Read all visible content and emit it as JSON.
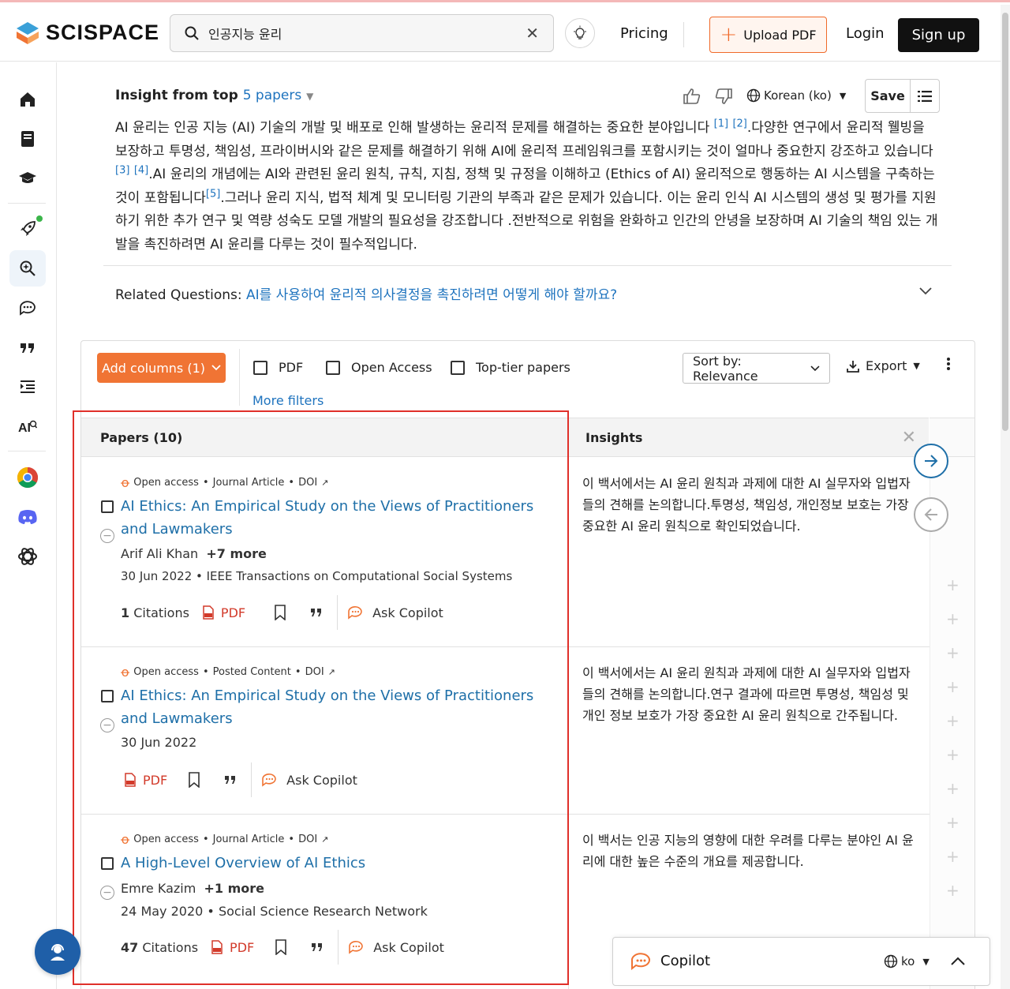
{
  "header": {
    "logo_text": "SCISPACE",
    "search_query": "인공지능 윤리",
    "pricing_label": "Pricing",
    "upload_label": "Upload PDF",
    "login_label": "Login",
    "signup_label": "Sign up"
  },
  "sidebar": {
    "items": [
      "home-icon",
      "library-icon",
      "graduation-cap-icon",
      "rocket-icon",
      "search-literature-icon",
      "chat-icon",
      "quote-icon",
      "outline-icon",
      "ai-detector-icon",
      "chrome-icon",
      "discord-icon",
      "openai-icon"
    ],
    "active_item": "search-literature-icon"
  },
  "insight": {
    "heading_prefix": "Insight from top",
    "papers_link": "5 papers",
    "language": "Korean (ko)",
    "save_label": "Save",
    "body": {
      "s1": "AI 윤리는 인공 지능 (AI) 기술의 개발 및 배포로 인해 발생하는 윤리적 문제를 해결하는 중요한 분야입니다",
      "c1": "[1]",
      "c2": "[2]",
      "s2": ".다양한 연구에서 윤리적 웰빙을 보장하고 투명성, 책임성, 프라이버시와 같은 문제를 해결하기 위해 AI에 윤리적 프레임워크를 포함시키는 것이 얼마나 중요한지 강조하고 있습니다",
      "c3": "[3]",
      "c4": "[4]",
      "s3": ".AI 윤리의 개념에는 AI와 관련된 윤리 원칙, 규칙, 지침, 정책 및 규정을 이해하고 (Ethics of AI) 윤리적으로 행동하는 AI 시스템을 구축하는 것이 포함됩니다",
      "c5": "[5]",
      "s4": ".그러나 윤리 지식, 법적 체계 및 모니터링 기관의 부족과 같은 문제가 있습니다. 이는 윤리 인식 AI 시스템의 생성 및 평가를 지원하기 위한 추가 연구 및 역량 성숙도 모델 개발의 필요성을 강조합니다 .전반적으로 위험을 완화하고 인간의 안녕을 보장하며 AI 기술의 책임 있는 개발을 촉진하려면 AI 윤리를 다루는 것이 필수적입니다."
    },
    "related_label": "Related Questions:",
    "related_question": "AI를 사용하여 윤리적 의사결정을 촉진하려면 어떻게 해야 할까요?"
  },
  "toolbar": {
    "add_columns_label": "Add columns (1)",
    "filters": [
      "PDF",
      "Open Access",
      "Top-tier papers"
    ],
    "more_filters": "More filters",
    "sort_label": "Sort by: Relevance",
    "export_label": "Export"
  },
  "table": {
    "papers_header": "Papers (10)",
    "insights_header": "Insights",
    "papers": [
      {
        "access": "Open access",
        "type": "Journal Article",
        "doi": "DOI",
        "title": "AI Ethics: An Empirical Study on the Views of Practitioners and Lawmakers",
        "author": "Arif Ali Khan",
        "more_authors": "+7 more",
        "date": "30 Jun 2022",
        "venue": "IEEE Transactions on Computational Social Systems",
        "citations_count": "1",
        "citations_label": "Citations",
        "pdf_label": "PDF",
        "copilot_label": "Ask Copilot",
        "insight": "이 백서에서는 AI 윤리 원칙과 과제에 대한 AI 실무자와 입법자들의 견해를 논의합니다.투명성, 책임성, 개인정보 보호는 가장 중요한 AI 윤리 원칙으로 확인되었습니다."
      },
      {
        "access": "Open access",
        "type": "Posted Content",
        "doi": "DOI",
        "title": "AI Ethics: An Empirical Study on the Views of Practitioners and Lawmakers",
        "date": "30 Jun 2022",
        "pdf_label": "PDF",
        "copilot_label": "Ask Copilot",
        "insight": "이 백서에서는 AI 윤리 원칙과 과제에 대한 AI 실무자와 입법자들의 견해를 논의합니다.연구 결과에 따르면 투명성, 책임성 및 개인 정보 보호가 가장 중요한 AI 윤리 원칙으로 간주됩니다."
      },
      {
        "access": "Open access",
        "type": "Journal Article",
        "doi": "DOI",
        "title": "A High-Level Overview of AI Ethics",
        "author": "Emre Kazim",
        "more_authors": "+1 more",
        "date": "24 May 2020",
        "venue": "Social Science Research Network",
        "citations_count": "47",
        "citations_label": "Citations",
        "pdf_label": "PDF",
        "copilot_label": "Ask Copilot",
        "insight": "이 백서는 인공 지능의 영향에 대한 우려를 다루는 분야인 AI 윤리에 대한 높은 수준의 개요를 제공합니다."
      }
    ]
  },
  "copilot_bar": {
    "label": "Copilot",
    "language": "ko"
  },
  "colors": {
    "accent_orange": "#f07434",
    "link_blue": "#1e73be",
    "highlight_red": "#e0302a"
  }
}
